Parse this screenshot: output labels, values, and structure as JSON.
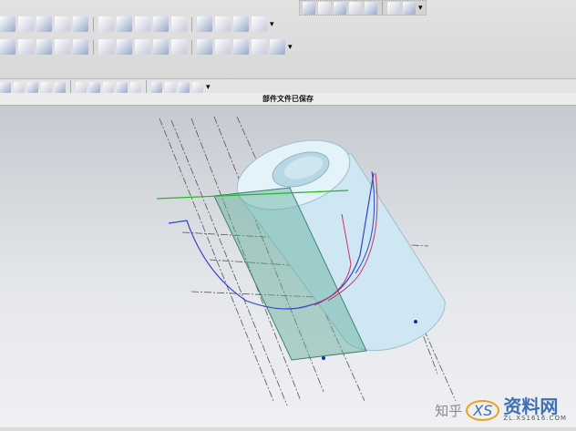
{
  "status": {
    "message": "部件文件已保存"
  },
  "toolbars": {
    "row1": [
      "view-icon",
      "surface-icon",
      "extrude-icon",
      "revolve-icon",
      "sheet-icon",
      "block-feature-icon",
      "pad-icon",
      "boss-icon",
      "pocket-icon",
      "slot-icon",
      "groove-icon",
      "box-icon",
      "plane-icon",
      "view-cube-icon"
    ],
    "row2": [
      "cone-icon",
      "block-icon",
      "cube-icon",
      "cylinder-icon",
      "cylinder2-icon",
      "pen-icon",
      "torus-icon",
      "trim-icon",
      "thicken-icon",
      "triangle-icon",
      "image-icon",
      "pattern-icon",
      "assembly-icon",
      "gear-icon",
      "gear2-icon"
    ],
    "row3": [
      "render-icon",
      "shaded-icon",
      "points-icon",
      "snap-icon",
      "line-icon",
      "line2-icon",
      "curve-icon",
      "arrow-icon",
      "circle-center-icon",
      "circle-icon",
      "plus-icon",
      "line3-icon",
      "hand-icon",
      "layer-icon"
    ],
    "topright": [
      "book-icon",
      "book2-icon",
      "cloud-icon",
      "diamond-icon",
      "people-icon",
      "curve-tool-icon",
      "camera-icon"
    ]
  },
  "colors": {
    "accent": "#3f6fb5",
    "cylinder": "#cfe7f2",
    "plane": "#5fae9a",
    "datum_line": "#22b822",
    "curve": "#3344cc"
  },
  "watermark": {
    "zhihu": "知乎",
    "brand": "资料网",
    "url": "ZL.XS1616.COM",
    "logo": "XS"
  }
}
